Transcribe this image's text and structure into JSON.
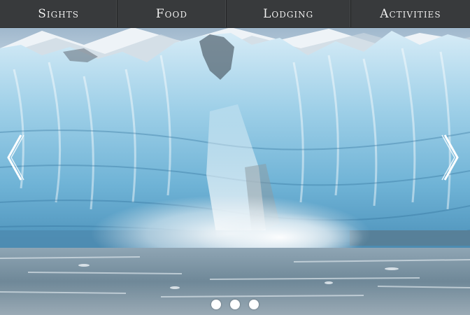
{
  "nav": {
    "items": [
      {
        "label": "Sights"
      },
      {
        "label": "Food"
      },
      {
        "label": "Lodging"
      },
      {
        "label": "Activities"
      }
    ]
  },
  "carousel": {
    "slide_count": 3,
    "icons": {
      "previous": "chevron-left-icon",
      "next": "chevron-right-icon"
    }
  },
  "colors": {
    "nav_background": "#3c3e40",
    "nav_text": "#f4f4f4",
    "dot": "#ffffff",
    "arrow": "#ffffff"
  }
}
